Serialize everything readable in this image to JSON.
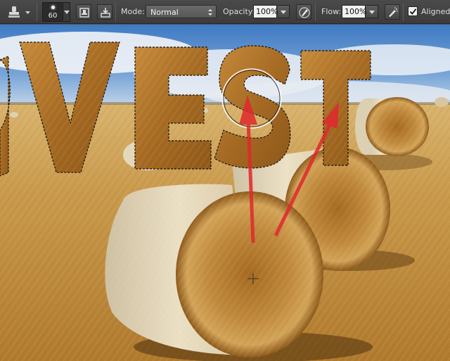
{
  "options_bar": {
    "tool_icon": "clone-stamp-icon",
    "brush": {
      "size": "60"
    },
    "toggle_clone_source_icon": "clone-source-panel-icon",
    "toggle_brush_panel_icon": "brush-panel-icon",
    "mode": {
      "label": "Mode:",
      "value": "Normal"
    },
    "opacity": {
      "label": "Opacity:",
      "value": "100%"
    },
    "pressure_opacity_icon": "pen-pressure-opacity-icon",
    "flow": {
      "label": "Flow:",
      "value": "100%"
    },
    "airbrush_icon": "airbrush-icon",
    "aligned": {
      "label": "Aligned",
      "checked": true
    }
  },
  "canvas": {
    "text_layer": "RVEST",
    "clone_source_annotation": "red-arrows",
    "colors": {
      "sky": "#4f86c9",
      "straw": "#c69040",
      "arrow": "#e0282c",
      "bar": "#3f3f3f"
    }
  }
}
